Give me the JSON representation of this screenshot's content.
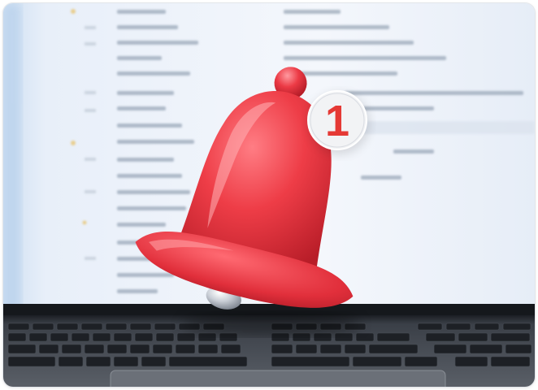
{
  "photo": {
    "subject": "notification-bell-over-laptop",
    "badge": {
      "count": "1"
    },
    "colors": {
      "bell": "#e8323e",
      "bell_highlight": "#ff8a8f",
      "badge_bg": "#f2f3f5",
      "badge_text": "#e53935",
      "screen": "#eef3fb",
      "keyboard": "#2b2f36"
    }
  }
}
